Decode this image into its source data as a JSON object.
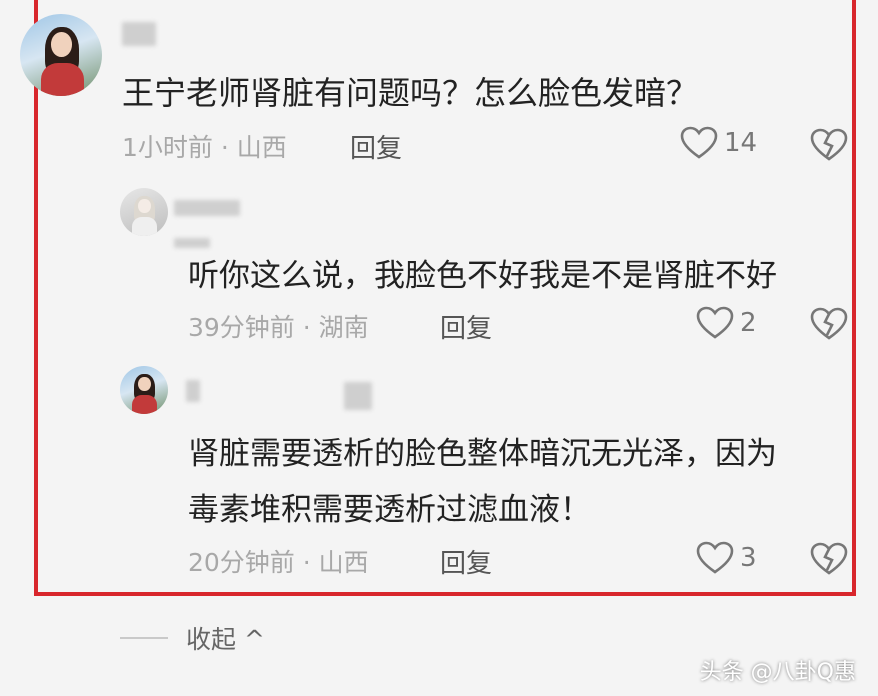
{
  "comments": [
    {
      "text": "王宁老师肾脏有问题吗？怎么脸色发暗？",
      "time_location": "1小时前 · 山西",
      "reply_label": "回复",
      "likes": "14"
    },
    {
      "text": "听你这么说，我脸色不好我是不是肾脏不好",
      "time_location": "39分钟前 · 湖南",
      "reply_label": "回复",
      "likes": "2"
    },
    {
      "text_line1": "肾脏需要透析的脸色整体暗沉无光泽，因为",
      "text_line2": "毒素堆积需要透析过滤血液！",
      "time_location": "20分钟前 · 山西",
      "reply_label": "回复",
      "likes": "3"
    }
  ],
  "collapse_label": "收起 ^",
  "watermark": "头条 @八卦Q惠",
  "colors": {
    "highlight_border": "#d8262c",
    "background": "#f4f4f4"
  }
}
